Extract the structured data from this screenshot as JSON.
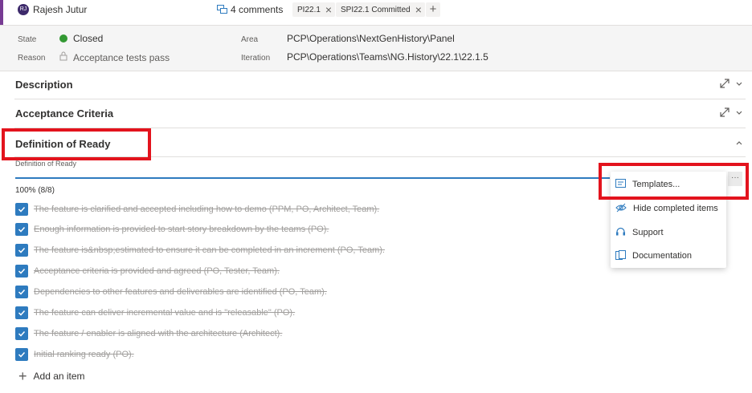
{
  "header": {
    "avatar_initials": "RJ",
    "user_name": "Rajesh Jutur",
    "comments_label": "4 comments",
    "tags": [
      "PI22.1",
      "SPI22.1 Committed"
    ]
  },
  "fields": {
    "state_label": "State",
    "state_value": "Closed",
    "state_color": "#339933",
    "reason_label": "Reason",
    "reason_value": "Acceptance tests pass",
    "area_label": "Area",
    "area_value": "PCP\\Operations\\NextGenHistory\\Panel",
    "iteration_label": "Iteration",
    "iteration_value": "PCP\\Operations\\Teams\\NG.History\\22.1\\22.1.5"
  },
  "sections": {
    "description": "Description",
    "acceptance": "Acceptance Criteria",
    "dor": "Definition of Ready"
  },
  "checklist": {
    "field_label": "Definition of Ready",
    "progress_text": "100% (8/8)",
    "progress_fraction": 1.0,
    "items": [
      "The feature is clarified and accepted including how to demo (PPM, PO, Architect, Team).",
      "Enough information is provided to start story breakdown by the teams (PO).",
      "The feature is&nbsp;estimated to ensure it can be completed in an increment (PO, Team).",
      "Acceptance criteria is provided and agreed (PO, Tester, Team).",
      "Dependencies to other features and deliverables are identified (PO, Team).",
      "The feature can deliver incremental value and is \"releasable\" (PO).",
      "The feature / enabler is aligned with the architecture (Architect).",
      "Initial ranking ready (PO)."
    ],
    "add_label": "Add an item",
    "menu_button": "···"
  },
  "menu": {
    "items": [
      "Templates...",
      "Hide completed items",
      "Support",
      "Documentation"
    ]
  },
  "colors": {
    "accent": "#2e7bbf",
    "highlight": "#e3131d",
    "avatar": "#3d2a6b",
    "bar": "#773b93"
  }
}
